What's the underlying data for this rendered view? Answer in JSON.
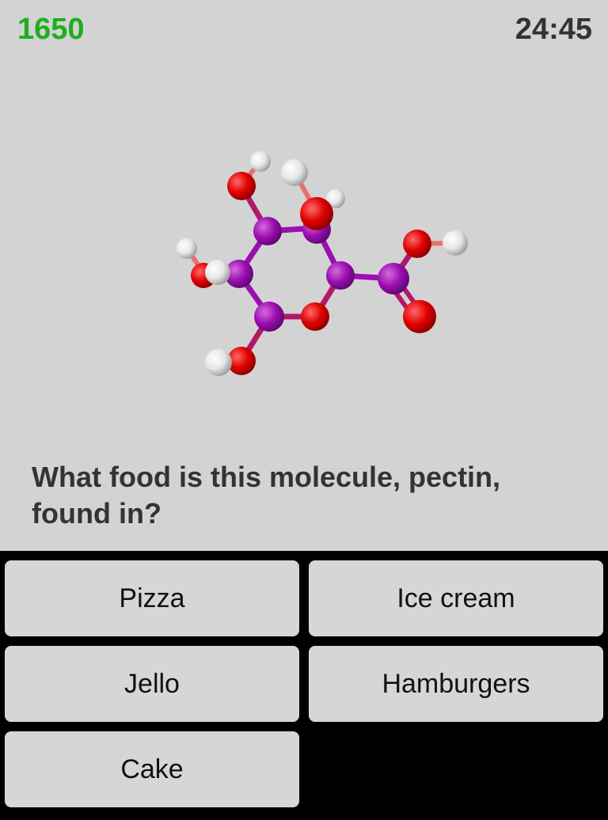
{
  "header": {
    "score": "1650",
    "timer": "24:45"
  },
  "colors": {
    "score": "#1fae1f",
    "carbon": "#9b0fb0",
    "oxygen": "#e00000",
    "hydrogen": "#e6e6e6",
    "background": "#d3d3d3",
    "answer_panel": "#000000"
  },
  "question": {
    "text": "What food is this molecule, pectin, found in?"
  },
  "answers": [
    {
      "label": "Pizza"
    },
    {
      "label": "Ice cream"
    },
    {
      "label": "Jello"
    },
    {
      "label": "Hamburgers"
    },
    {
      "label": "Cake"
    }
  ]
}
